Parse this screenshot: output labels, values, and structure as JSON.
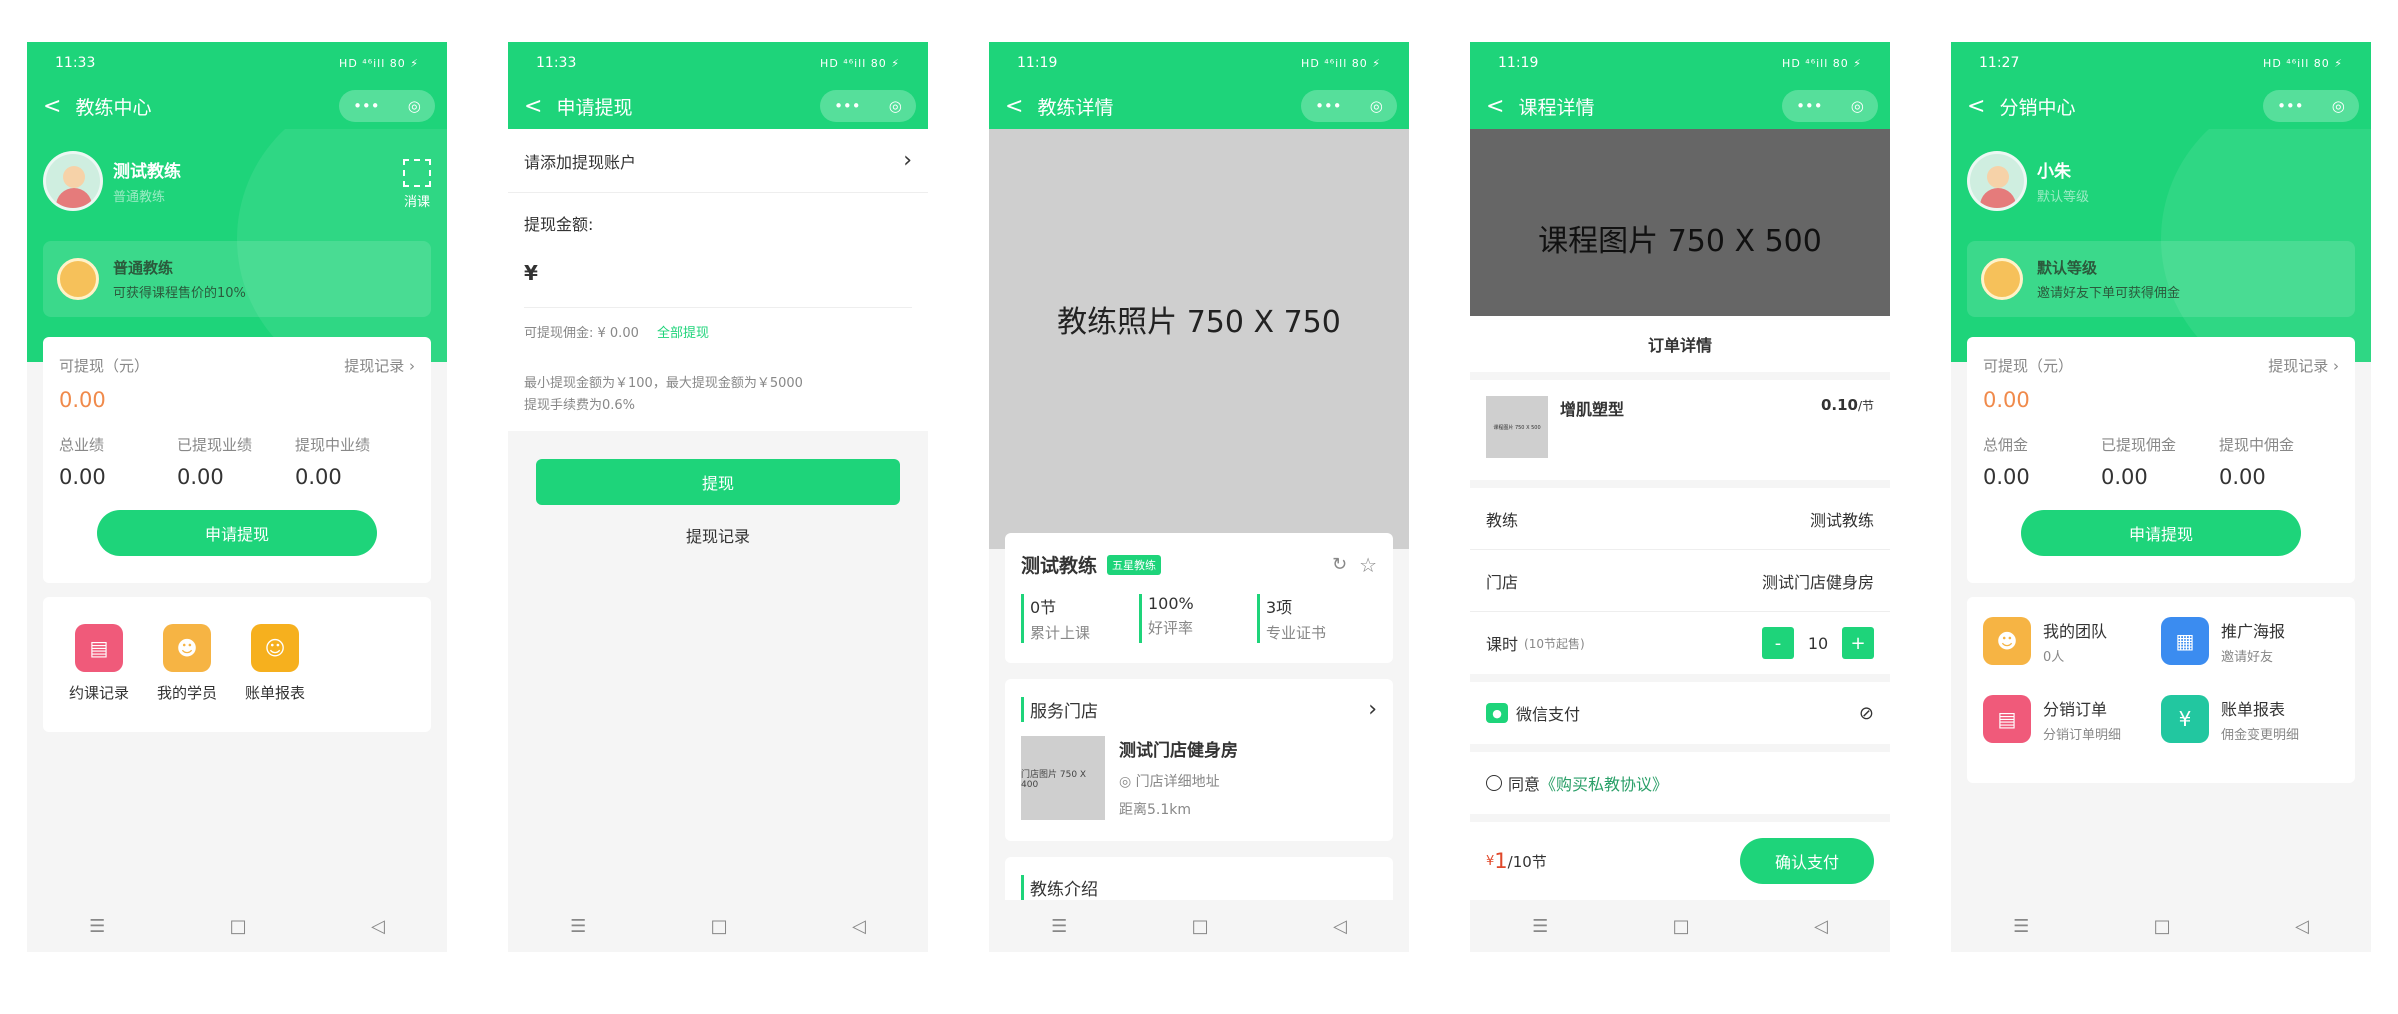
{
  "status_times": [
    "11:33",
    "11:33",
    "11:19",
    "11:19",
    "11:27"
  ],
  "status_icons": "HD ⁴⁶ill 80 ⚡",
  "nav_back": "<",
  "capsule_dots": "•••",
  "capsule_target": "◎",
  "bottom_nav": [
    "☰",
    "□",
    "◁"
  ],
  "s1": {
    "title": "教练中心",
    "name": "测试教练",
    "role": "普通教练",
    "scan": "消课",
    "level_title": "普通教练",
    "level_desc": "可获得课程售价的10%",
    "withdrawable_label": "可提现（元）",
    "withdraw_record": "提现记录",
    "withdrawable_value": "0.00",
    "stats": [
      {
        "label": "总业绩",
        "value": "0.00"
      },
      {
        "label": "已提现业绩",
        "value": "0.00"
      },
      {
        "label": "提现中业绩",
        "value": "0.00"
      }
    ],
    "apply_btn": "申请提现",
    "menu": [
      "约课记录",
      "我的学员",
      "账单报表"
    ]
  },
  "s2": {
    "title": "申请提现",
    "add_account": "请添加提现账户",
    "amount_label": "提现金额:",
    "currency": "¥",
    "commission": "可提现佣金: ¥ 0.00",
    "all": "全部提现",
    "limits": "最小提现金额为￥100，最大提现金额为￥5000",
    "fee": "提现手续费为0.6%",
    "btn": "提现",
    "record": "提现记录"
  },
  "s3": {
    "title": "教练详情",
    "photo": "教练照片 750 X 750",
    "name": "测试教练",
    "badge": "五星教练",
    "stats": [
      {
        "value": "0节",
        "label": "累计上课"
      },
      {
        "value": "100%",
        "label": "好评率"
      },
      {
        "value": "3项",
        "label": "专业证书"
      }
    ],
    "store_section": "服务门店",
    "store_thumb": "门店图片 750 X 400",
    "store_name": "测试门店健身房",
    "store_addr": "门店详细地址",
    "store_dist": "距离5.1km",
    "intro": "教练介绍"
  },
  "s4": {
    "title": "课程详情",
    "img": "课程图片 750 X 500",
    "order_title": "订单详情",
    "course_thumb": "课程图片 750 X 500",
    "course_name": "增肌塑型",
    "course_price": "0.10",
    "per": "/节",
    "coach_label": "教练",
    "coach_value": "测试教练",
    "store_label": "门店",
    "store_value": "测试门店健身房",
    "hours_label": "课时",
    "hours_hint": "(10节起售)",
    "minus": "-",
    "qty": "10",
    "plus": "+",
    "pay": "微信支付",
    "agree": "同意",
    "agreement": "《购买私教协议》",
    "total_symbol": "¥",
    "total": "1",
    "total_unit": "/10节",
    "confirm": "确认支付"
  },
  "s5": {
    "title": "分销中心",
    "name": "小朱",
    "role": "默认等级",
    "level_title": "默认等级",
    "level_desc": "邀请好友下单可获得佣金",
    "withdrawable_label": "可提现（元）",
    "withdraw_record": "提现记录",
    "withdrawable_value": "0.00",
    "stats": [
      {
        "label": "总佣金",
        "value": "0.00"
      },
      {
        "label": "已提现佣金",
        "value": "0.00"
      },
      {
        "label": "提现中佣金",
        "value": "0.00"
      }
    ],
    "apply_btn": "申请提现",
    "grid": [
      {
        "title": "我的团队",
        "sub": "0人"
      },
      {
        "title": "推广海报",
        "sub": "邀请好友"
      },
      {
        "title": "分销订单",
        "sub": "分销订单明细"
      },
      {
        "title": "账单报表",
        "sub": "佣金变更明细"
      }
    ]
  },
  "colors": {
    "brand": "#1ed47a",
    "accent": "#f08a4b"
  }
}
